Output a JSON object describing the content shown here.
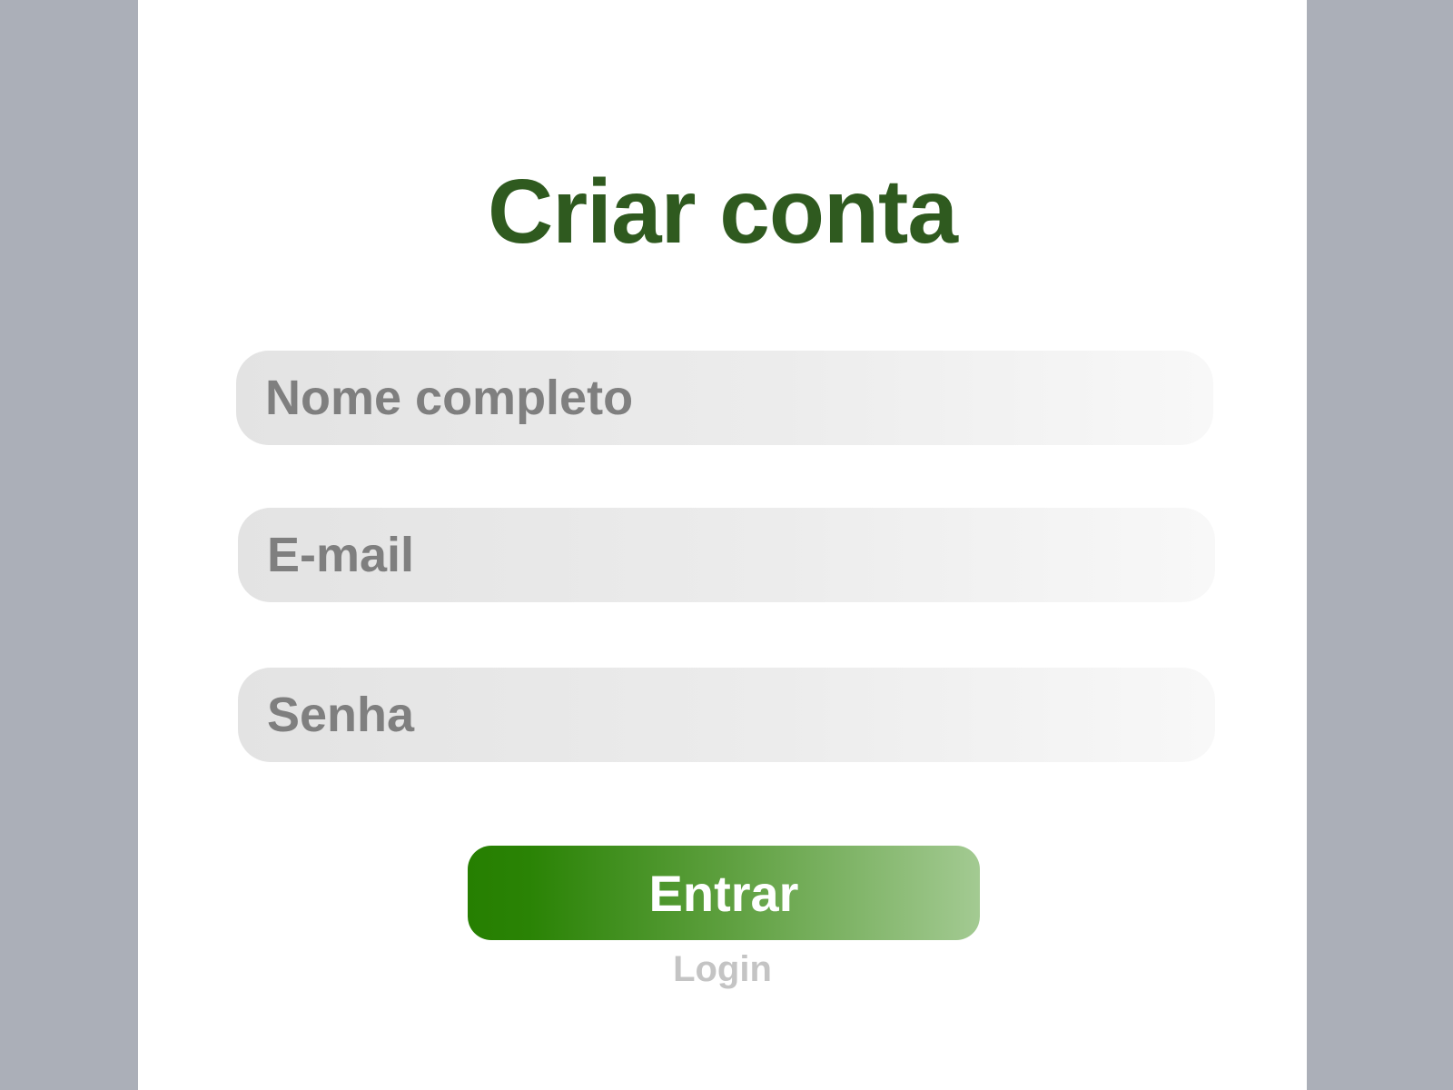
{
  "page": {
    "title": "Criar conta"
  },
  "form": {
    "name_placeholder": "Nome completo",
    "email_placeholder": "E-mail",
    "password_placeholder": "Senha",
    "submit_label": "Entrar",
    "login_link": "Login"
  },
  "colors": {
    "background": "#abafb8",
    "panel": "#ffffff",
    "title": "#2f5a1f",
    "field_text": "#7f7f7f",
    "button_start": "#267f01",
    "button_end": "#a3ca92",
    "link": "#c4c4c4"
  }
}
